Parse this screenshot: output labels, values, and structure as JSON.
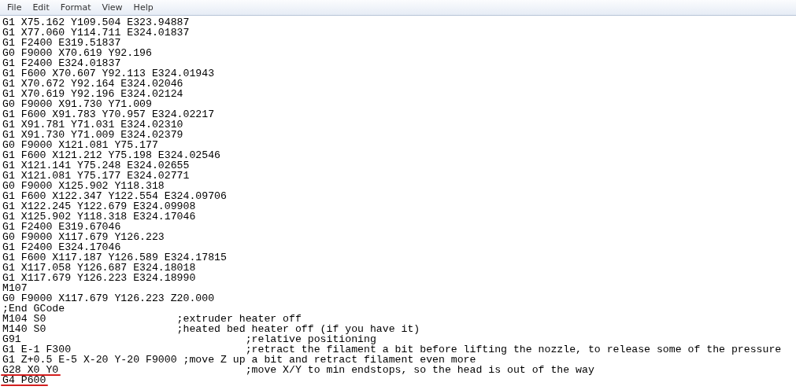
{
  "menu": [
    "File",
    "Edit",
    "Format",
    "View",
    "Help"
  ],
  "lines": [
    {
      "text": "G1 X75.162 Y109.504 E323.94887",
      "underlined": false
    },
    {
      "text": "G1 X77.060 Y114.711 E324.01837",
      "underlined": false
    },
    {
      "text": "G1 F2400 E319.51837",
      "underlined": false
    },
    {
      "text": "G0 F9000 X70.619 Y92.196",
      "underlined": false
    },
    {
      "text": "G1 F2400 E324.01837",
      "underlined": false
    },
    {
      "text": "G1 F600 X70.607 Y92.113 E324.01943",
      "underlined": false
    },
    {
      "text": "G1 X70.672 Y92.164 E324.02046",
      "underlined": false
    },
    {
      "text": "G1 X70.619 Y92.196 E324.02124",
      "underlined": false
    },
    {
      "text": "G0 F9000 X91.730 Y71.009",
      "underlined": false
    },
    {
      "text": "G1 F600 X91.783 Y70.957 E324.02217",
      "underlined": false
    },
    {
      "text": "G1 X91.781 Y71.031 E324.02310",
      "underlined": false
    },
    {
      "text": "G1 X91.730 Y71.009 E324.02379",
      "underlined": false
    },
    {
      "text": "G0 F9000 X121.081 Y75.177",
      "underlined": false
    },
    {
      "text": "G1 F600 X121.212 Y75.198 E324.02546",
      "underlined": false
    },
    {
      "text": "G1 X121.141 Y75.248 E324.02655",
      "underlined": false
    },
    {
      "text": "G1 X121.081 Y75.177 E324.02771",
      "underlined": false
    },
    {
      "text": "G0 F9000 X125.902 Y118.318",
      "underlined": false
    },
    {
      "text": "G1 F600 X122.347 Y122.554 E324.09706",
      "underlined": false
    },
    {
      "text": "G1 X122.245 Y122.679 E324.09908",
      "underlined": false
    },
    {
      "text": "G1 X125.902 Y118.318 E324.17046",
      "underlined": false
    },
    {
      "text": "G1 F2400 E319.67046",
      "underlined": false
    },
    {
      "text": "G0 F9000 X117.679 Y126.223",
      "underlined": false
    },
    {
      "text": "G1 F2400 E324.17046",
      "underlined": false
    },
    {
      "text": "G1 F600 X117.187 Y126.589 E324.17815",
      "underlined": false
    },
    {
      "text": "G1 X117.058 Y126.687 E324.18018",
      "underlined": false
    },
    {
      "text": "G1 X117.679 Y126.223 E324.18990",
      "underlined": false
    },
    {
      "text": "M107",
      "underlined": false
    },
    {
      "text": "G0 F9000 X117.679 Y126.223 Z20.000",
      "underlined": false
    },
    {
      "text": ";End GCode",
      "underlined": false
    },
    {
      "text": "M104 S0                     ;extruder heater off",
      "underlined": false
    },
    {
      "text": "M140 S0                     ;heated bed heater off (if you have it)",
      "underlined": false
    },
    {
      "text": "G91                                    ;relative positioning",
      "underlined": false
    },
    {
      "text": "G1 E-1 F300                            ;retract the filament a bit before lifting the nozzle, to release some of the pressure",
      "underlined": false
    },
    {
      "text": "G1 Z+0.5 E-5 X-20 Y-20 F9000 ;move Z up a bit and retract filament even more",
      "underlined": false
    },
    {
      "text": "G28 X0 Y0                              ;move X/Y to min endstops, so the head is out of the way",
      "underlined": true
    },
    {
      "text": "G4 P600",
      "underlined": true
    }
  ]
}
